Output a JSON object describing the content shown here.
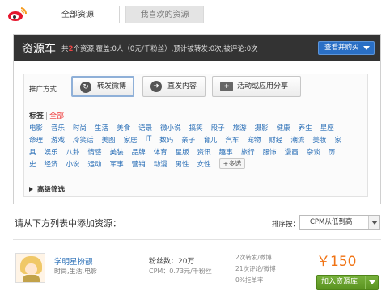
{
  "header": {
    "tabs": [
      {
        "label": "全部资源",
        "active": true
      },
      {
        "label": "我喜欢的资源",
        "active": false
      }
    ]
  },
  "resource_bar": {
    "title": "资源车",
    "stats_prefix": "共",
    "count": "2",
    "stats_suffix": "个资源,覆盖:0人（0元/千粉丝）,预计被转发:0次,被评论:0次",
    "cart_button": "查看并购买"
  },
  "promo": {
    "label": "推广方式",
    "options": [
      {
        "label": "转发微博",
        "icon": "repost-icon",
        "selected": true
      },
      {
        "label": "直发内容",
        "icon": "post-icon",
        "selected": false
      },
      {
        "label": "活动或应用分享",
        "icon": "gamepad-icon",
        "selected": false
      }
    ]
  },
  "tags": {
    "label": "标签",
    "separator": "|",
    "all": "全部",
    "row1": [
      "电影",
      "音乐",
      "时尚",
      "生活",
      "美食",
      "语录",
      "微小说",
      "搞笑",
      "段子",
      "旅游",
      "摄影",
      "健康",
      "养生",
      "星座"
    ],
    "row2": [
      "命理",
      "游戏",
      "冷笑话",
      "美图",
      "家居",
      "IT",
      "数码",
      "亲子",
      "育儿",
      "汽车",
      "宠物",
      "财经",
      "潮流",
      "美妆",
      "家"
    ],
    "row3": [
      "具",
      "娱乐",
      "八卦",
      "情感",
      "美装",
      "品牌",
      "体育",
      "星版",
      "资讯",
      "趣事",
      "旅行",
      "服饰",
      "漫画",
      "杂谈",
      "历"
    ],
    "row4": [
      "史",
      "经济",
      "小说",
      "运动",
      "军事",
      "营销",
      "动漫",
      "男性",
      "女性"
    ],
    "more": "+多选"
  },
  "advanced": {
    "label": "高级筛选"
  },
  "list": {
    "add_prompt": "请从下方列表中添加资源：",
    "sort_label": "排序按：",
    "sort_value": "CPM从低到高"
  },
  "item": {
    "name": "学明星扮靓",
    "category": "时尚,生活,电影",
    "fans": "粉丝数：20万",
    "cpm": "CPM：0.73元/千粉丝",
    "stats": [
      "2次转发/微博",
      "21次评论/微博",
      "0%拒单率"
    ],
    "price": "￥150",
    "add_button": "加入资源库"
  }
}
